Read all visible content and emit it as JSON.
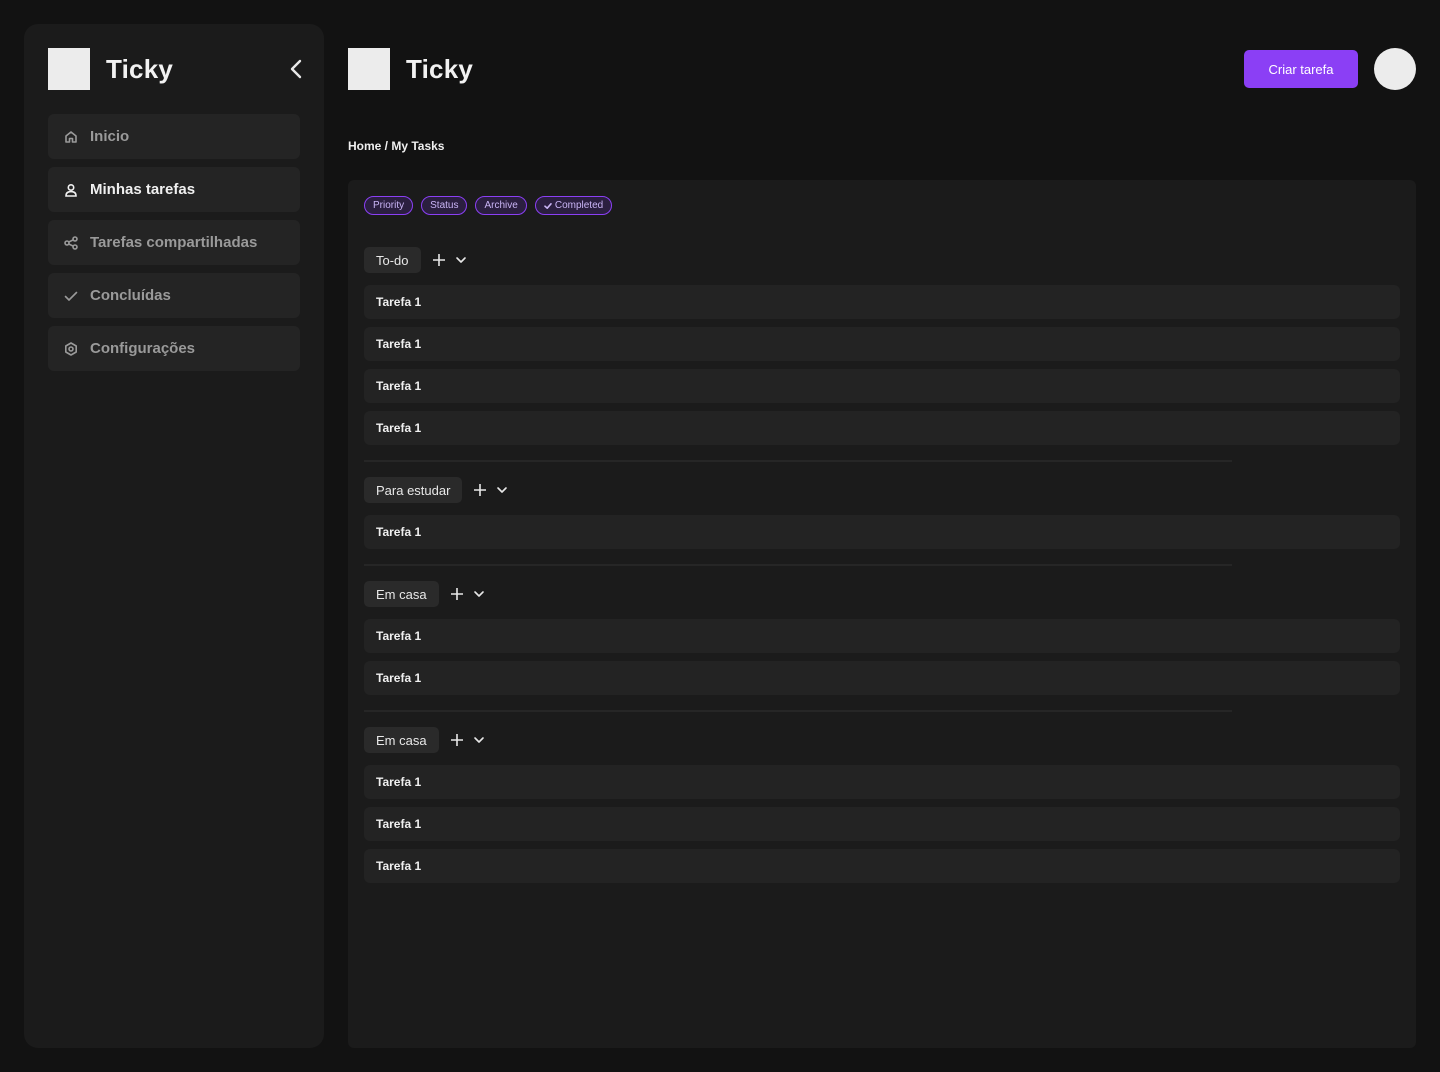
{
  "app": {
    "name": "Ticky"
  },
  "sidebar": {
    "items": [
      {
        "label": "Inicio",
        "icon": "home-icon",
        "active": false
      },
      {
        "label": "Minhas tarefas",
        "icon": "user-icon",
        "active": true
      },
      {
        "label": "Tarefas compartilhadas",
        "icon": "share-icon",
        "active": false
      },
      {
        "label": "Concluídas",
        "icon": "check-icon",
        "active": false
      },
      {
        "label": "Configurações",
        "icon": "settings-icon",
        "active": false
      }
    ]
  },
  "header": {
    "create_label": "Criar tarefa"
  },
  "breadcrumb": "Home / My Tasks",
  "filters": [
    {
      "label": "Priority",
      "checked": false
    },
    {
      "label": "Status",
      "checked": false
    },
    {
      "label": "Archive",
      "checked": false
    },
    {
      "label": "Completed",
      "checked": true
    }
  ],
  "groups": [
    {
      "label": "To-do",
      "tasks": [
        "Tarefa 1",
        "Tarefa 1",
        "Tarefa 1",
        "Tarefa 1"
      ]
    },
    {
      "label": "Para estudar",
      "tasks": [
        "Tarefa 1"
      ]
    },
    {
      "label": "Em casa",
      "tasks": [
        "Tarefa 1",
        "Tarefa 1"
      ]
    },
    {
      "label": "Em casa",
      "tasks": [
        "Tarefa 1",
        "Tarefa 1",
        "Tarefa 1"
      ]
    }
  ],
  "colors": {
    "accent": "#8b3ff5",
    "background": "#121212",
    "panel": "#1b1b1b"
  }
}
